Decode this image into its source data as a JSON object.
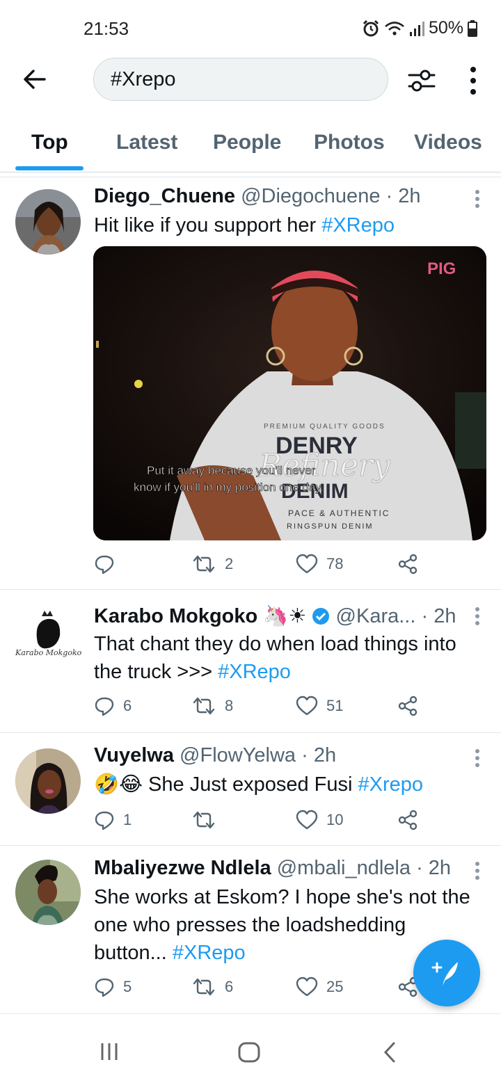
{
  "status_bar": {
    "time": "21:53",
    "battery": "50%",
    "icons": [
      "alarm-icon",
      "wifi-icon",
      "signal-icon",
      "battery-icon"
    ]
  },
  "search": {
    "query": "#Xrepo"
  },
  "tabs": [
    {
      "label": "Top",
      "active": true
    },
    {
      "label": "Latest",
      "active": false
    },
    {
      "label": "People",
      "active": false
    },
    {
      "label": "Photos",
      "active": false
    },
    {
      "label": "Videos",
      "active": false
    }
  ],
  "tweets": [
    {
      "name": "Diego_Chuene",
      "handle": "@Diegochuene",
      "time": "· 2h",
      "text": "Hit like if you support her ",
      "hashtag": "#XRepo",
      "media": {
        "watermark": "PIG",
        "subtitle_line1": "Put it away because you'll never",
        "subtitle_line2": "know if you'll in my position one day.",
        "shirt_line1": "PREMIUM QUALITY GOODS",
        "shirt_line2": "DENRY",
        "shirt_script": "Refinery",
        "shirt_line3": "DENIM",
        "shirt_line4": "PACE & AUTHENTIC",
        "shirt_line5": "RINGSPUN DENIM"
      },
      "replies": "",
      "retweets": "2",
      "likes": "78"
    },
    {
      "name": "Karabo Mokgoko",
      "emoji": "🦄☀",
      "handle": "@Kara...",
      "time": "· 2h",
      "avatar_logo_text": "Karabo Mokgoko",
      "text": "That chant they do when load things into the truck >>> ",
      "hashtag": "#XRepo",
      "replies": "6",
      "retweets": "8",
      "likes": "51"
    },
    {
      "name": "Vuyelwa",
      "handle": "@FlowYelwa",
      "time": "· 2h",
      "emoji": "🤣😂",
      "text": " She Just exposed Fusi ",
      "hashtag": "#Xrepo",
      "replies": "1",
      "retweets": "",
      "likes": "10"
    },
    {
      "name": "Mbaliyezwe Ndlela",
      "handle": "@mbali_ndlela",
      "time": "· 2h",
      "text": "She works at Eskom? I hope she's not the one who presses the loadshedding button... ",
      "hashtag": "#XRepo",
      "replies": "5",
      "retweets": "6",
      "likes": "25"
    }
  ],
  "colors": {
    "accent": "#1d9bf0",
    "text": "#0f1419",
    "muted": "#536471",
    "border": "#e1e8ed"
  }
}
